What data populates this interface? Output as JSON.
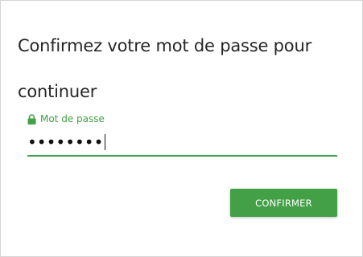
{
  "dialog": {
    "title": "Confirmez votre mot de passe pour continuer"
  },
  "password_field": {
    "label": "Mot de passe",
    "value": "••••••••",
    "icon": "lock-icon"
  },
  "actions": {
    "confirm_label": "CONFIRMER"
  },
  "colors": {
    "accent": "#43a047",
    "title_text": "#262626",
    "border": "#d6d6d6"
  }
}
